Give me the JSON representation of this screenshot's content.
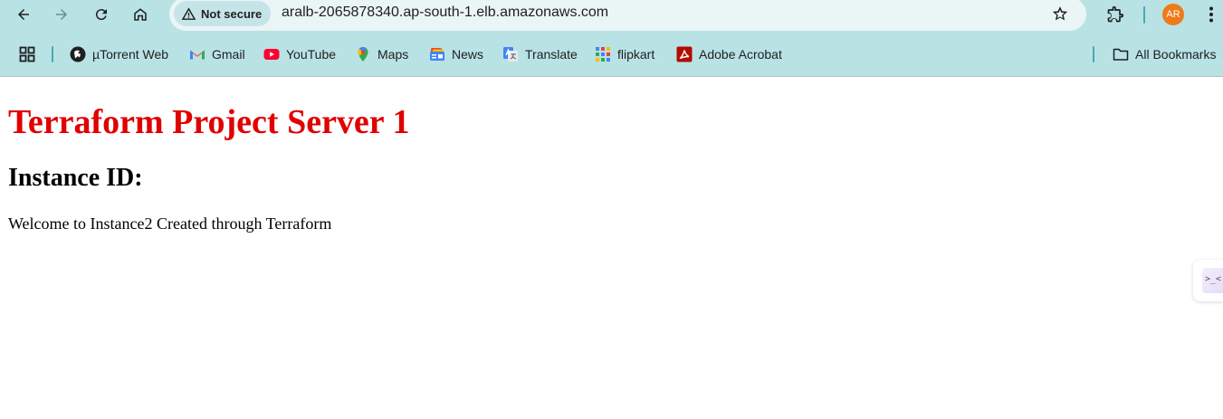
{
  "browser": {
    "security_label": "Not secure",
    "url": "aralb-2065878340.ap-south-1.elb.amazonaws.com",
    "profile_initials": "AR",
    "colors": {
      "chrome_bg": "#b9e2e5",
      "omnibox_bg": "#eaf5f6",
      "avatar_bg": "#ef7a1a"
    },
    "toolbar_icons": [
      "back-icon",
      "forward-icon",
      "reload-icon",
      "home-icon",
      "warning-icon",
      "star-icon",
      "extensions-icon",
      "kebab-menu-icon"
    ]
  },
  "bookmarks": {
    "items": [
      {
        "label": "µTorrent Web",
        "icon": "utorrent-icon"
      },
      {
        "label": "Gmail",
        "icon": "gmail-icon"
      },
      {
        "label": "YouTube",
        "icon": "youtube-icon"
      },
      {
        "label": "Maps",
        "icon": "maps-icon"
      },
      {
        "label": "News",
        "icon": "news-icon"
      },
      {
        "label": "Translate",
        "icon": "translate-icon"
      },
      {
        "label": "flipkart",
        "icon": "flipkart-icon"
      },
      {
        "label": "Adobe Acrobat",
        "icon": "acrobat-icon"
      }
    ],
    "all_bookmarks_label": "All Bookmarks"
  },
  "page": {
    "title": "Terraform Project Server 1",
    "instance_heading": "Instance ID:",
    "welcome": "Welcome to Instance2 Created through Terraform",
    "side_widget_text": ">_<",
    "colors": {
      "title": "#e00000"
    }
  }
}
